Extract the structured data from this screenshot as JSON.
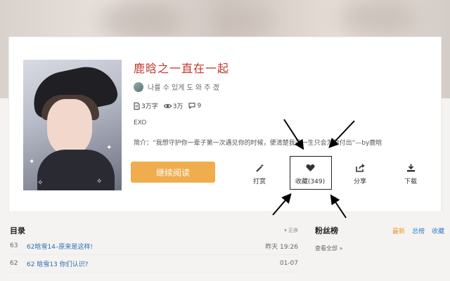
{
  "book": {
    "title": "鹿晗之一直在一起",
    "author": "나를 수 있게 도 와 주 겠",
    "stats": {
      "words": "3万字",
      "views": "3万",
      "comments": "9"
    },
    "tag": "EXO",
    "intro": "简介：“我想守护你一辈子第一次遇见你的时候，便清楚我这一生只会为你付出”—by鹿晗"
  },
  "actions": {
    "read_label": "继续阅读",
    "reward_label": "打赏",
    "collect_label": "收藏(349)",
    "share_label": "分享",
    "download_label": "下载"
  },
  "toc": {
    "title": "目录",
    "sort_label": "正序",
    "rows": [
      {
        "num": "63",
        "name": "62晗雪14–原来是这样!",
        "time": "昨天 19:26"
      },
      {
        "num": "62",
        "name": "62 晗雪13 你们认识?",
        "time": "01-07"
      }
    ]
  },
  "fans": {
    "title": "粉丝榜",
    "tabs": [
      "最新",
      "总榜",
      "收藏"
    ],
    "view_all": "查看全部 »"
  },
  "colors": {
    "title": "#c0392b",
    "read_button": "#f0ad4e",
    "link": "#2b6cb0",
    "fans_active": "#e49a2b"
  },
  "icons": {
    "words": "document-icon",
    "views": "eye-icon",
    "comments": "comment-icon",
    "reward": "magic-wand-icon",
    "collect": "heart-icon",
    "share": "share-icon",
    "download": "download-icon",
    "sort": "sort-arrow-icon"
  }
}
